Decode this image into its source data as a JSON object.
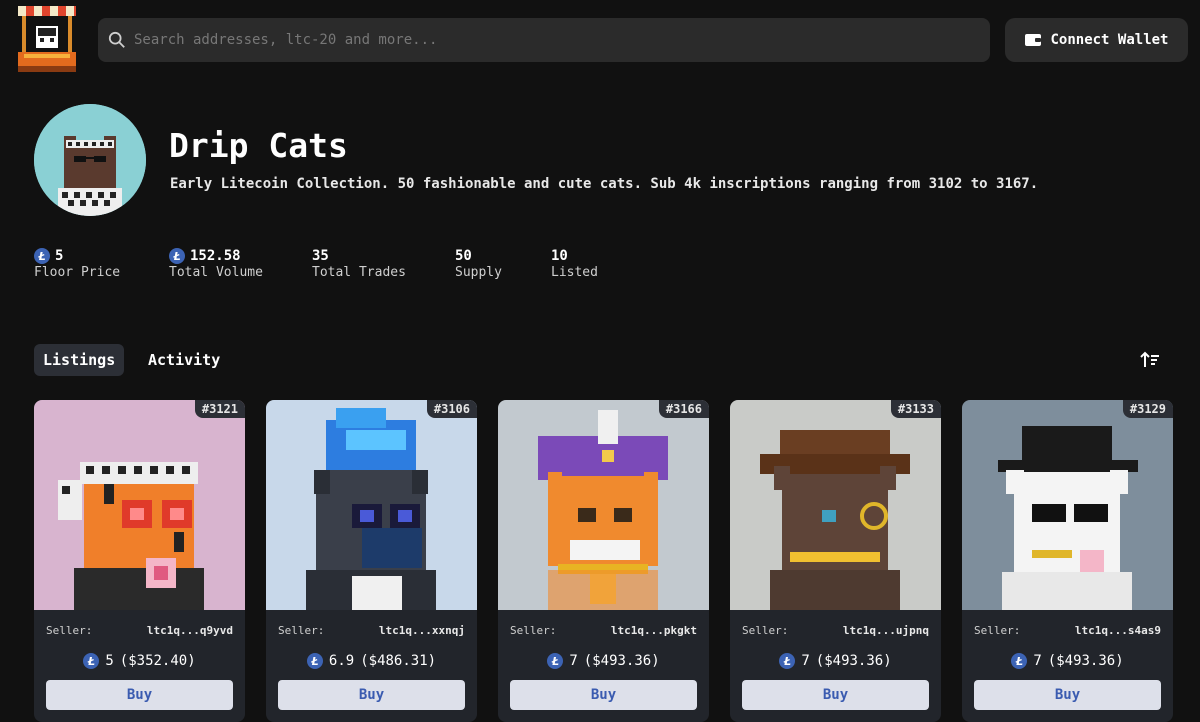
{
  "header": {
    "search_placeholder": "Search addresses, ltc-20 and more...",
    "connect_label": "Connect Wallet"
  },
  "collection": {
    "title": "Drip Cats",
    "description": "Early Litecoin Collection. 50 fashionable and cute cats. Sub 4k inscriptions ranging from 3102 to 3167.",
    "stats": [
      {
        "value": "5",
        "label": "Floor Price",
        "coin": true
      },
      {
        "value": "152.58",
        "label": "Total Volume",
        "coin": true
      },
      {
        "value": "35",
        "label": "Total Trades",
        "coin": false
      },
      {
        "value": "50",
        "label": "Supply",
        "coin": false
      },
      {
        "value": "10",
        "label": "Listed",
        "coin": false
      }
    ]
  },
  "tabs": {
    "listings": "Listings",
    "activity": "Activity"
  },
  "cards": [
    {
      "id": "#3121",
      "seller_label": "Seller:",
      "seller": "ltc1q...q9yvd",
      "price": "5",
      "usd": "($352.40)",
      "buy": "Buy"
    },
    {
      "id": "#3106",
      "seller_label": "Seller:",
      "seller": "ltc1q...xxnqj",
      "price": "6.9",
      "usd": "($486.31)",
      "buy": "Buy"
    },
    {
      "id": "#3166",
      "seller_label": "Seller:",
      "seller": "ltc1q...pkgkt",
      "price": "7",
      "usd": "($493.36)",
      "buy": "Buy"
    },
    {
      "id": "#3133",
      "seller_label": "Seller:",
      "seller": "ltc1q...ujpnq",
      "price": "7",
      "usd": "($493.36)",
      "buy": "Buy"
    },
    {
      "id": "#3129",
      "seller_label": "Seller:",
      "seller": "ltc1q...s4as9",
      "price": "7",
      "usd": "($493.36)",
      "buy": "Buy"
    }
  ],
  "coin_glyph": "Ł",
  "colors": {
    "background": "#111111",
    "panel": "#2b2b2b",
    "card": "#22252b",
    "accent": "#3c63b4",
    "buy_bg": "#dde0ea"
  }
}
